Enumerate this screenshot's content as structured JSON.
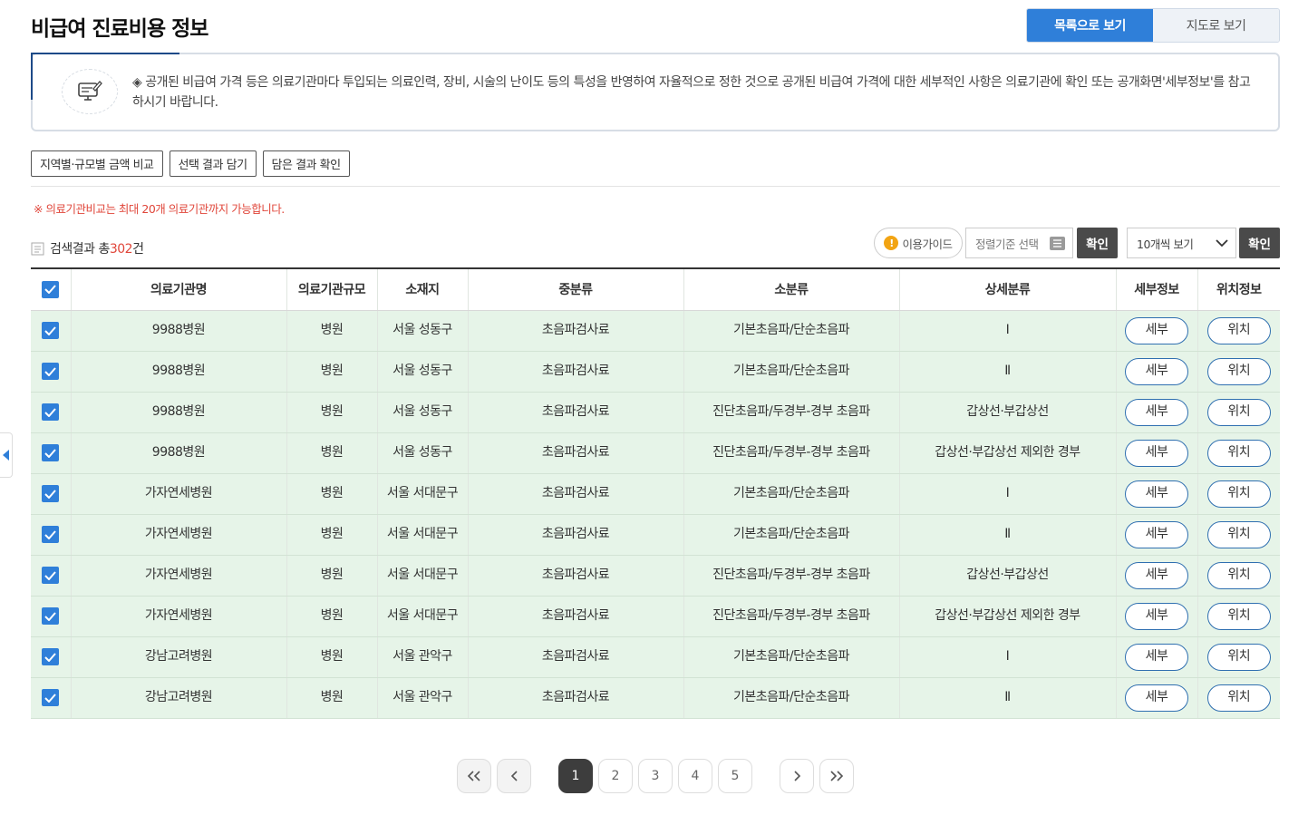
{
  "header": {
    "title": "비급여 진료비용 정보",
    "view_list": "목록으로 보기",
    "view_map": "지도로 보기"
  },
  "notice": {
    "text": "◈ 공개된 비급여 가격 등은 의료기관마다 투입되는 의료인력, 장비, 시술의 난이도 등의 특성을 반영하여 자율적으로 정한 것으로 공개된 비급여 가격에 대한 세부적인 사항은 의료기관에 확인 또는 공개화면'세부정보'를 참고하시기 바랍니다."
  },
  "toolbar": {
    "compare": "지역별·규모별 금액 비교",
    "save_selected": "선택 결과 담기",
    "check_saved": "담은 결과 확인"
  },
  "warning": "※ 의료기관비교는 최대 20개 의료기관까지 가능합니다.",
  "result": {
    "prefix": "검색결과 총",
    "count": "302",
    "suffix": "건"
  },
  "controls": {
    "guide": "이용가이드",
    "sort_placeholder": "정렬기준 선택",
    "confirm": "확인",
    "per_page": "10개씩 보기"
  },
  "table": {
    "headers": [
      "의료기관명",
      "의료기관규모",
      "소재지",
      "중분류",
      "소분류",
      "상세분류",
      "세부정보",
      "위치정보"
    ],
    "detail_label": "세부",
    "location_label": "위치",
    "rows": [
      {
        "name": "9988병원",
        "size": "병원",
        "loc": "서울 성동구",
        "mid": "초음파검사료",
        "small": "기본초음파/단순초음파",
        "detail": "Ⅰ"
      },
      {
        "name": "9988병원",
        "size": "병원",
        "loc": "서울 성동구",
        "mid": "초음파검사료",
        "small": "기본초음파/단순초음파",
        "detail": "Ⅱ"
      },
      {
        "name": "9988병원",
        "size": "병원",
        "loc": "서울 성동구",
        "mid": "초음파검사료",
        "small": "진단초음파/두경부-경부 초음파",
        "detail": "갑상선·부갑상선"
      },
      {
        "name": "9988병원",
        "size": "병원",
        "loc": "서울 성동구",
        "mid": "초음파검사료",
        "small": "진단초음파/두경부-경부 초음파",
        "detail": "갑상선·부갑상선 제외한 경부"
      },
      {
        "name": "가자연세병원",
        "size": "병원",
        "loc": "서울 서대문구",
        "mid": "초음파검사료",
        "small": "기본초음파/단순초음파",
        "detail": "Ⅰ"
      },
      {
        "name": "가자연세병원",
        "size": "병원",
        "loc": "서울 서대문구",
        "mid": "초음파검사료",
        "small": "기본초음파/단순초음파",
        "detail": "Ⅱ"
      },
      {
        "name": "가자연세병원",
        "size": "병원",
        "loc": "서울 서대문구",
        "mid": "초음파검사료",
        "small": "진단초음파/두경부-경부 초음파",
        "detail": "갑상선·부갑상선"
      },
      {
        "name": "가자연세병원",
        "size": "병원",
        "loc": "서울 서대문구",
        "mid": "초음파검사료",
        "small": "진단초음파/두경부-경부 초음파",
        "detail": "갑상선·부갑상선 제외한 경부"
      },
      {
        "name": "강남고려병원",
        "size": "병원",
        "loc": "서울 관악구",
        "mid": "초음파검사료",
        "small": "기본초음파/단순초음파",
        "detail": "Ⅰ"
      },
      {
        "name": "강남고려병원",
        "size": "병원",
        "loc": "서울 관악구",
        "mid": "초음파검사료",
        "small": "기본초음파/단순초음파",
        "detail": "Ⅱ"
      }
    ]
  },
  "pagination": {
    "pages": [
      "1",
      "2",
      "3",
      "4",
      "5"
    ],
    "current": "1"
  },
  "colors": {
    "accent": "#2f7fd9",
    "row_bg": "#e6f4e8",
    "warning": "#e0463a",
    "dark_button": "#4a4a4a"
  }
}
